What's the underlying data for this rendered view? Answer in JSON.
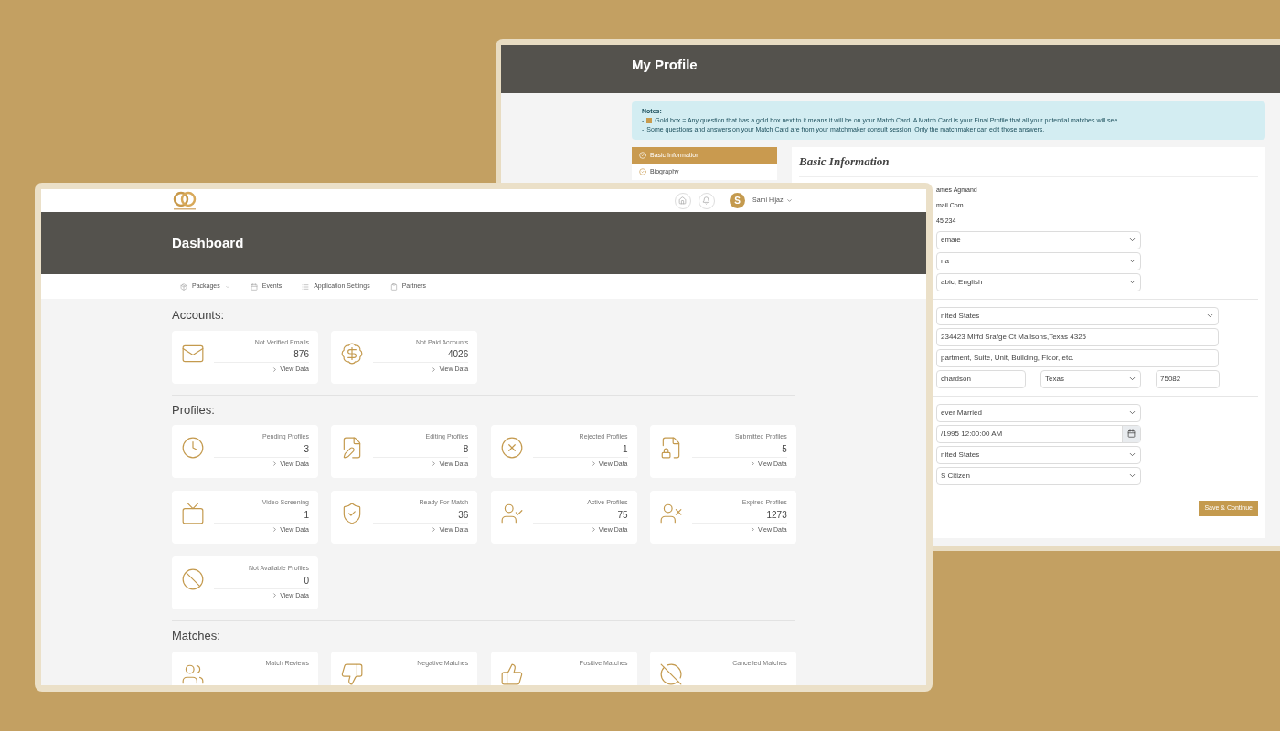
{
  "profile_window": {
    "title": "My Profile",
    "notes": {
      "heading": "Notes:",
      "lines": [
        {
          "dash": "-",
          "gold_box": true,
          "text": "Gold box = Any question that has a gold box next to it means it will be on your Match Card. A Match Card is your Final Profile that all your potential matches will see."
        },
        {
          "dash": "-",
          "gold_box": false,
          "text": "Some questions and answers on your Match Card are from your matchmaker consult session. Only the matchmaker can edit those answers."
        }
      ]
    },
    "steps": [
      {
        "label": "Basic Information",
        "selected": true
      },
      {
        "label": "Biography",
        "selected": false
      }
    ],
    "card_title": "Basic Information",
    "groups": [
      [
        [
          {
            "kind": "text",
            "value": "ames Agmand"
          }
        ],
        [
          {
            "kind": "text",
            "value": "mail.Com"
          }
        ],
        [
          {
            "kind": "text",
            "value": "45 234"
          }
        ],
        [
          {
            "kind": "select",
            "value": "emale"
          }
        ],
        [
          {
            "kind": "select",
            "value": "na"
          }
        ],
        [
          {
            "kind": "select",
            "value": "abic, English"
          }
        ]
      ],
      [
        [
          {
            "kind": "select",
            "value": "nited States"
          }
        ],
        [
          {
            "kind": "input",
            "value": "234423 Mlffd Srafge Ct Mallsons,Texas 4325"
          }
        ],
        [
          {
            "kind": "input",
            "value": "partment, Suite, Unit, Building, Floor, etc."
          }
        ],
        [
          {
            "kind": "input",
            "value": "chardson"
          },
          {
            "kind": "select",
            "value": "Texas"
          },
          {
            "kind": "input",
            "value": "75082"
          }
        ]
      ],
      [
        [
          {
            "kind": "select",
            "value": "ever Married"
          }
        ],
        [
          {
            "kind": "date",
            "value": "/1995 12:00:00 AM"
          }
        ],
        [
          {
            "kind": "select",
            "value": "nited States"
          }
        ],
        [
          {
            "kind": "select",
            "value": "S Citizen"
          }
        ]
      ]
    ],
    "save_button": "Save & Continue"
  },
  "dashboard_window": {
    "user": {
      "initial": "S",
      "name": "Sami Hijazi"
    },
    "title": "Dashboard",
    "nav": [
      {
        "label": "Packages",
        "dropdown": true
      },
      {
        "label": "Events",
        "dropdown": false
      },
      {
        "label": "Application Settings",
        "dropdown": false
      },
      {
        "label": "Partners",
        "dropdown": false
      }
    ],
    "sections": [
      {
        "title": "Accounts:",
        "cards": [
          {
            "label": "Not Verified Emails",
            "count": "876",
            "link": "View Data"
          },
          {
            "label": "Not Paid Accounts",
            "count": "4026",
            "link": "View Data"
          }
        ]
      },
      {
        "title": "Profiles:",
        "cards": [
          {
            "label": "Pending Profiles",
            "count": "3",
            "link": "View Data"
          },
          {
            "label": "Editing Profiles",
            "count": "8",
            "link": "View Data"
          },
          {
            "label": "Rejected Profiles",
            "count": "1",
            "link": "View Data"
          },
          {
            "label": "Submitted Profiles",
            "count": "5",
            "link": "View Data"
          },
          {
            "label": "Video Screening",
            "count": "1",
            "link": "View Data"
          },
          {
            "label": "Ready For Match",
            "count": "36",
            "link": "View Data"
          },
          {
            "label": "Active Profiles",
            "count": "75",
            "link": "View Data"
          },
          {
            "label": "Expired Profiles",
            "count": "1273",
            "link": "View Data"
          },
          {
            "label": "Not Available Profiles",
            "count": "0",
            "link": "View Data"
          }
        ]
      },
      {
        "title": "Matches:",
        "cards": [
          {
            "label": "Match Reviews"
          },
          {
            "label": "Negative Matches"
          },
          {
            "label": "Positive Matches"
          },
          {
            "label": "Cancelled Matches"
          }
        ]
      }
    ]
  }
}
